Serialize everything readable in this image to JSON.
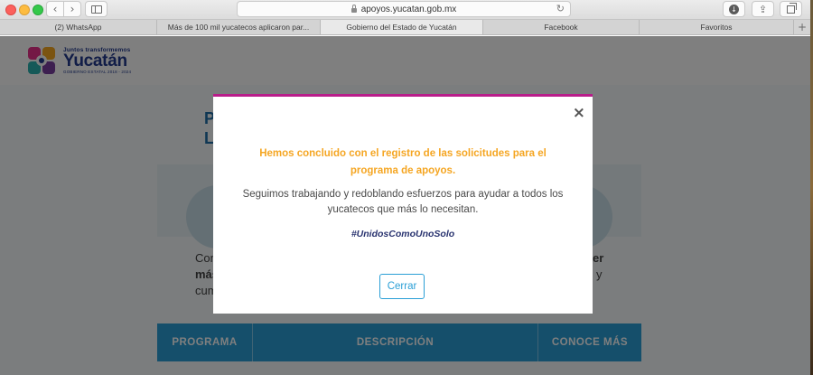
{
  "browser": {
    "url": "apoyos.yucatan.gob.mx",
    "tabs": [
      {
        "label": "(2) WhatsApp"
      },
      {
        "label": "Más de 100 mil yucatecos aplicaron par..."
      },
      {
        "label": "Gobierno del Estado de Yucatán"
      },
      {
        "label": "Facebook"
      },
      {
        "label": "Favoritos"
      }
    ],
    "new_tab_label": "+"
  },
  "site": {
    "logo_tagline": "Juntos transformemos",
    "logo_name": "Yucatán",
    "logo_sub": "GOBIERNO ESTATAL 2018 - 2024",
    "bg_heading_line1": "P",
    "bg_heading_line2": "L",
    "bg_text_left_1": "Con",
    "bg_text_left_2": "más",
    "bg_text_left_3": "cum",
    "bg_text_right_1": "er",
    "bg_text_right_2": "y",
    "table_headers": [
      "PROGRAMA",
      "DESCRIPCIÓN",
      "CONOCE MÁS"
    ]
  },
  "modal": {
    "title": "Hemos concluido con el registro de las solicitudes para el programa de apoyos.",
    "body": "Seguimos trabajando y redoblando esfuerzos para ayudar a todos los yucatecos que más lo necesitan.",
    "hashtag": "#UnidosComoUnoSolo",
    "close_button": "Cerrar",
    "close_icon": "×"
  },
  "colors": {
    "modal_accent": "#b81d8a",
    "title_orange": "#f5a623",
    "button_blue": "#2a9fd6"
  }
}
